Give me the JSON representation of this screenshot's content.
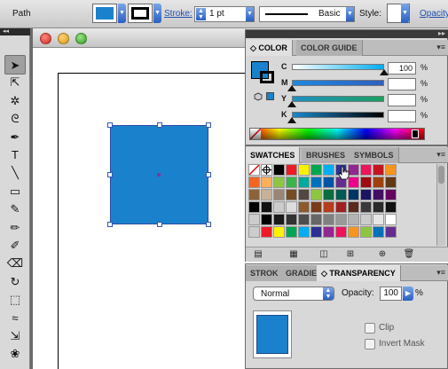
{
  "control_bar": {
    "path_label": "Path",
    "fill_color": "#1a82cc",
    "stroke_label": "Stroke:",
    "stroke_value": "1 pt",
    "brush_value": "Basic",
    "style_label": "Style:",
    "opacity_label": "Opacity"
  },
  "tools": [
    "selection-tool",
    "direct-selection-tool",
    "magic-wand-tool",
    "lasso-tool",
    "pen-tool",
    "type-tool",
    "line-tool",
    "rectangle-tool",
    "paintbrush-tool",
    "pencil-tool",
    "blob-brush-tool",
    "eraser-tool",
    "rotate-tool",
    "scale-tool",
    "warp-tool",
    "free-transform-tool",
    "symbol-sprayer-tool"
  ],
  "tool_glyphs": [
    "➤",
    "⇱",
    "✲",
    "ᘓ",
    "✒",
    "T",
    "╲",
    "▭",
    "✎",
    "✏",
    "✐",
    "⌫",
    "↻",
    "⬚",
    "≈",
    "⇲",
    "❀"
  ],
  "color_panel": {
    "tabs": [
      "COLOR",
      "COLOR GUIDE"
    ],
    "channels": [
      {
        "label": "C",
        "value": "100",
        "pct": 100,
        "track": "linear-gradient(to right,#ffffff,#00aeef)"
      },
      {
        "label": "M",
        "value": "",
        "pct": 0,
        "track": "linear-gradient(to right,#1e88e0,#3060c0)"
      },
      {
        "label": "Y",
        "value": "",
        "pct": 0,
        "track": "linear-gradient(to right,#1e90c0,#1aa060)"
      },
      {
        "label": "K",
        "value": "",
        "pct": 0,
        "track": "linear-gradient(to right,#1a88cc,#000000)"
      }
    ],
    "percent_sign": "%"
  },
  "swatches_panel": {
    "tabs": [
      "SWATCHES",
      "BRUSHES",
      "SYMBOLS"
    ],
    "rows": [
      [
        "#ffffff",
        "#ffffff",
        "#000000",
        "#ed1c24",
        "#fff200",
        "#00a651",
        "#00aeef",
        "#2e3192",
        "#92278f",
        "#ed145b",
        "#c4151c",
        "#f7941d"
      ],
      [
        "#f26522",
        "#fbaf5d",
        "#8dc63f",
        "#39b54a",
        "#00a99d",
        "#0072bc",
        "#0054a6",
        "#662d91",
        "#ec008c",
        "#9e0b0f",
        "#a0410d",
        "#603913"
      ],
      [
        "#8c6239",
        "#c7b299",
        "#998675",
        "#754c24",
        "#534741",
        "#8dc63f",
        "#0b6c3d",
        "#005952",
        "#003663",
        "#1b1464",
        "#440e62",
        "#630460"
      ],
      [
        "#000000",
        "#111111",
        "#cccccc",
        "#dddddd",
        "#8c5a2b",
        "#7a3a1a",
        "#b53c1c",
        "#a02020",
        "#5a2a1a",
        "#3a3a3a",
        "#2a2a2a",
        "#111111"
      ],
      [
        "#cccccc",
        "#000000",
        "#1a1a1a",
        "#333333",
        "#4d4d4d",
        "#666666",
        "#808080",
        "#999999",
        "#b3b3b3",
        "#cccccc",
        "#e6e6e6",
        "#ffffff"
      ],
      [
        "#cccccc",
        "#ed1c24",
        "#fff200",
        "#00a651",
        "#00aeef",
        "#2e3192",
        "#92278f",
        "#ed145b",
        "#f7941d",
        "#8dc63f",
        "#0072bc",
        "#662d91"
      ]
    ]
  },
  "transparency_panel": {
    "tabs": [
      "STROK",
      "GRADIE",
      "TRANSPARENCY"
    ],
    "blend_mode": "Normal",
    "opacity_label": "Opacity:",
    "opacity_value": "100",
    "percent_sign": "%",
    "clip_label": "Clip",
    "invert_mask_label": "Invert Mask",
    "thumb_color": "#1a82cc"
  }
}
